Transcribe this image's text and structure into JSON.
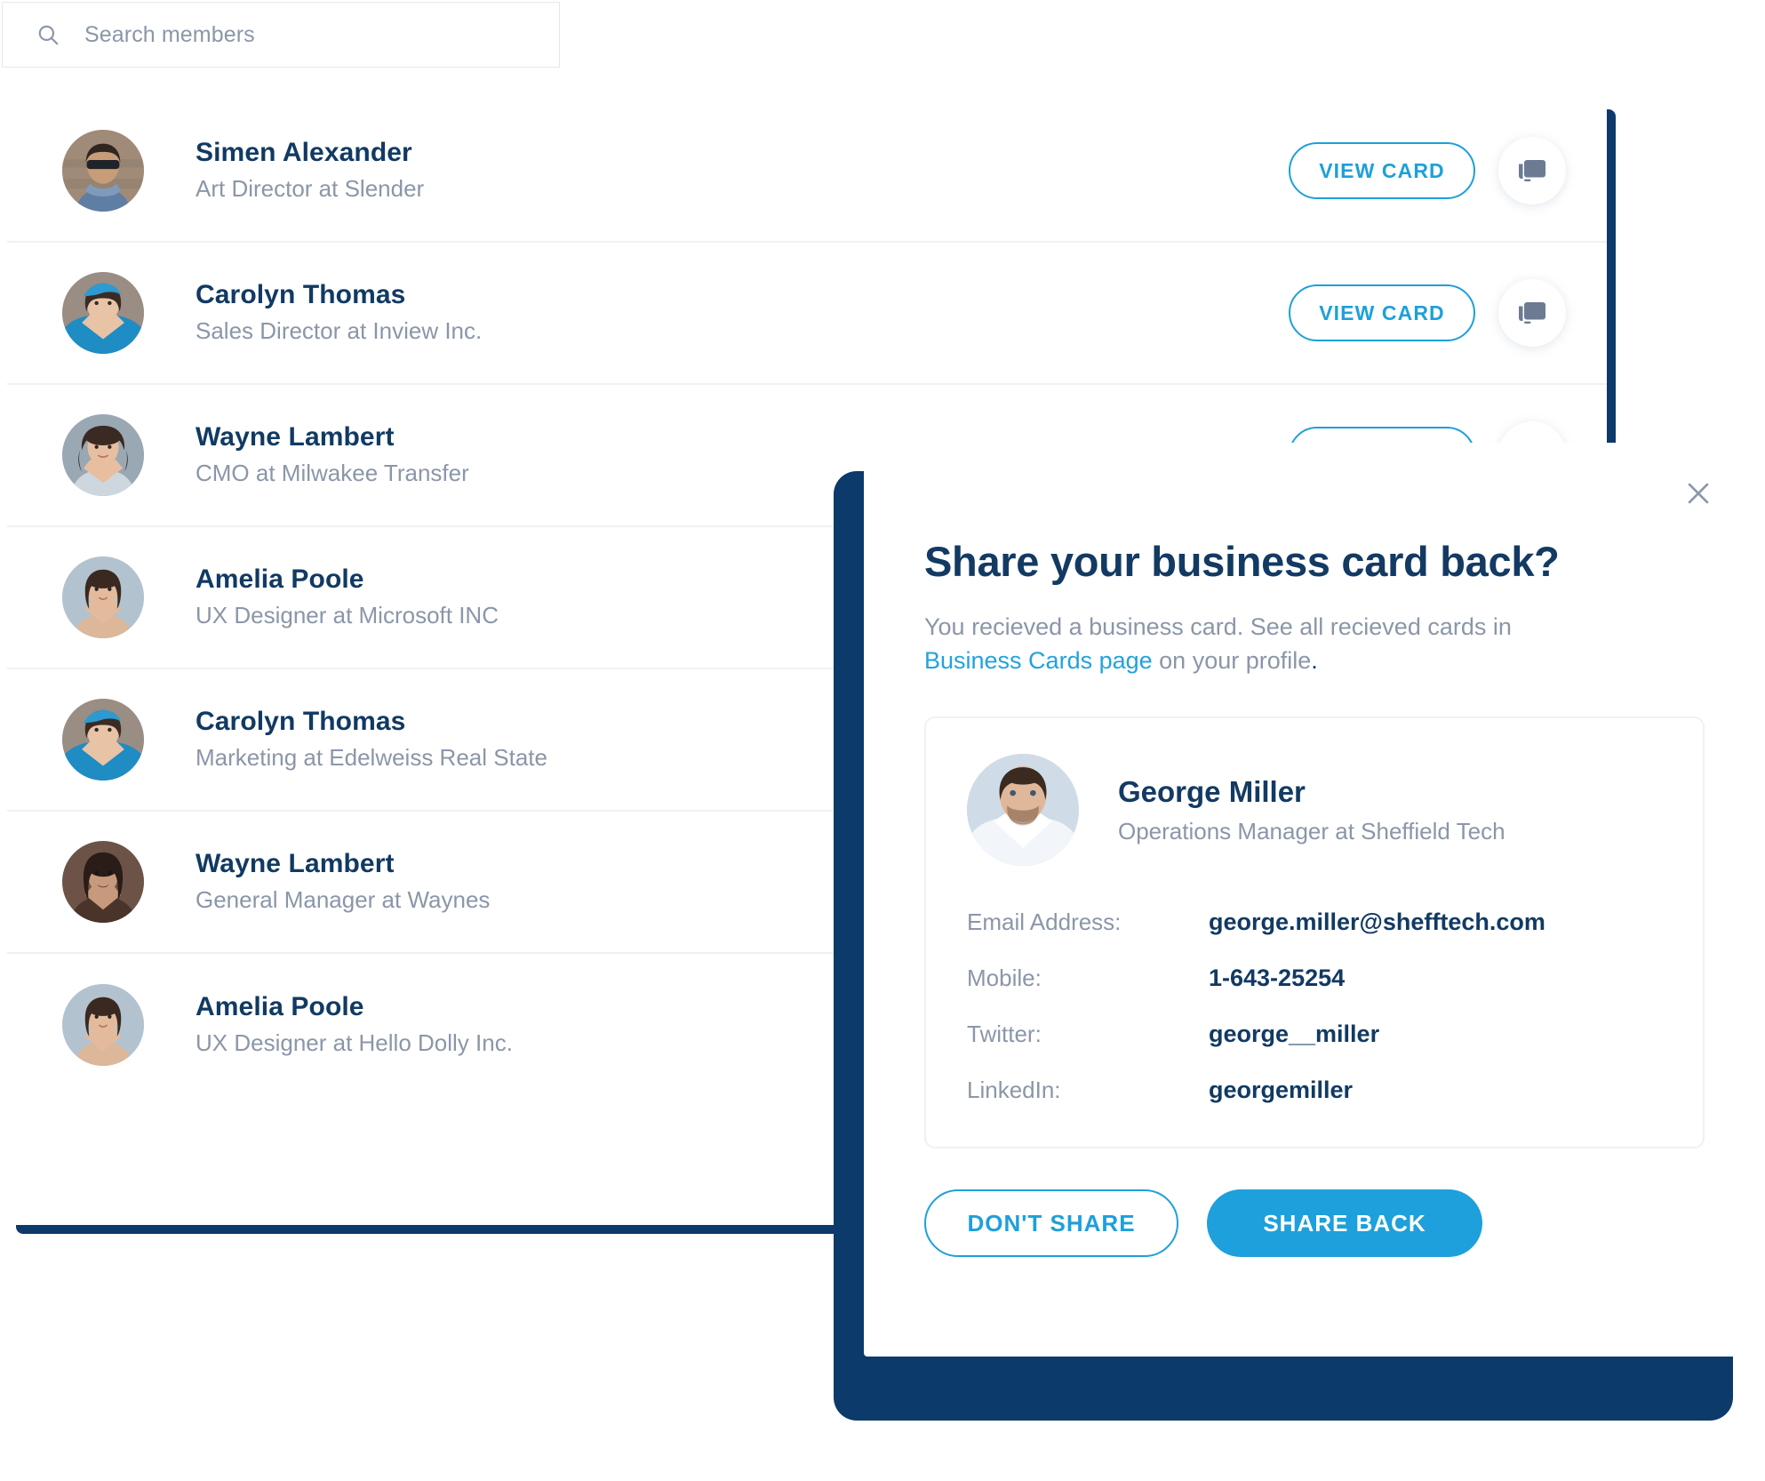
{
  "colors": {
    "accent": "#1da0db",
    "link": "#21a3dd",
    "navy": "#133a63",
    "muted": "#8b96a8",
    "shadow_navy": "#0b3a6b",
    "divider": "#eef1f5"
  },
  "search": {
    "placeholder": "Search members",
    "icon": "search-icon"
  },
  "members": {
    "view_card_label": "VIEW CARD",
    "card_icon": "business-card-icon",
    "rows": [
      {
        "name": "Simen Alexander",
        "role": "Art Director at Slender",
        "avatar": "man-sunglasses-denim"
      },
      {
        "name": "Carolyn Thomas",
        "role": "Sales Director at Inview Inc.",
        "avatar": "woman-blue-scarf"
      },
      {
        "name": "Wayne Lambert",
        "role": "CMO at Milwakee Transfer",
        "avatar": "woman-curly-hair"
      },
      {
        "name": "Amelia Poole",
        "role": "UX Designer at Microsoft INC",
        "avatar": "woman-bob-haircut"
      },
      {
        "name": "Carolyn Thomas",
        "role": "Marketing at Edelweiss Real State",
        "avatar": "woman-blue-scarf"
      },
      {
        "name": "Wayne Lambert",
        "role": "General Manager at Waynes",
        "avatar": "woman-dark-lipstick"
      },
      {
        "name": "Amelia Poole",
        "role": "UX Designer at Hello Dolly Inc.",
        "avatar": "woman-bob-haircut"
      }
    ]
  },
  "modal": {
    "close_icon": "close-icon",
    "title": "Share your business card back?",
    "subtitle_before": "You recieved a business card. See all recieved cards in ",
    "subtitle_link": "Business Cards page",
    "subtitle_after": " on your profile",
    "subtitle_period": ".",
    "card": {
      "avatar": "man-beard-white-shirt",
      "name": "George Miller",
      "role": "Operations Manager at Sheffield Tech",
      "fields": [
        {
          "label": "Email Address:",
          "value": "george.miller@shefftech.com"
        },
        {
          "label": "Mobile:",
          "value": "1-643-25254"
        },
        {
          "label": "Twitter:",
          "value": "george__miller"
        },
        {
          "label": "LinkedIn:",
          "value": "georgemiller"
        }
      ]
    },
    "dont_share_label": "DON'T SHARE",
    "share_back_label": "SHARE BACK"
  }
}
